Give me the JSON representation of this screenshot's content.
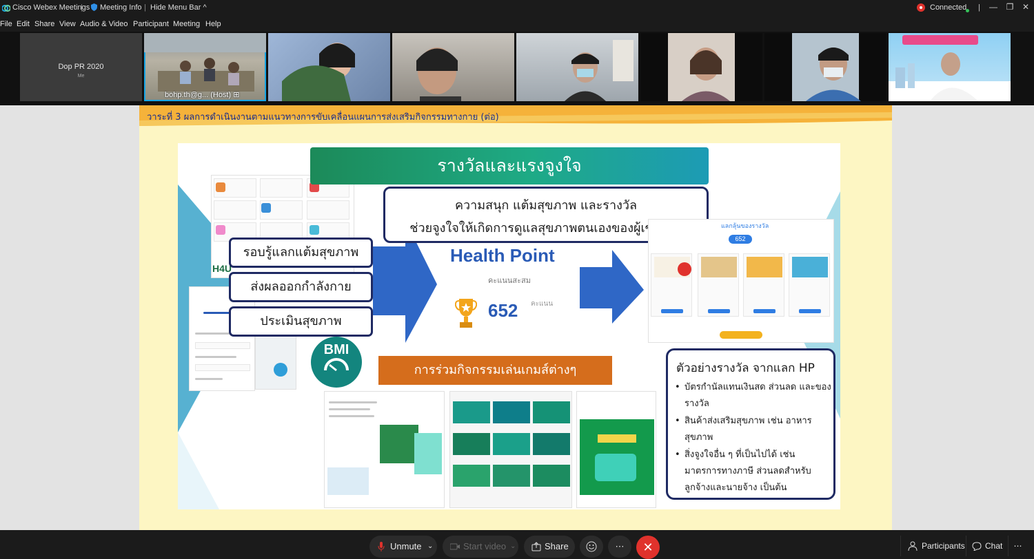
{
  "titlebar": {
    "app_name": "Cisco Webex Meetings",
    "meeting_info": "Meeting Info",
    "hide_menu": "Hide Menu Bar",
    "connected": "Connected"
  },
  "menu": [
    "File",
    "Edit",
    "Share",
    "View",
    "Audio & Video",
    "Participant",
    "Meeting",
    "Help"
  ],
  "participants": {
    "me_name": "Dop PR 2020",
    "me_sub": "Me",
    "host_label": "bohp.th@g... (Host)"
  },
  "slide": {
    "title": "วาระที่ 3  ผลการดำเนินงานตามแนวทางการขับเคลื่อนแผนการส่งเสริมกิจกรรมทางกาย (ต่อ)",
    "banner": "รางวัลและแรงจูงใจ",
    "motto_line1": "ความสนุก แต้มสุขภาพ และรางวัล",
    "motto_line2": "ช่วยจูงใจให้เกิดการดูแลสุขภาพตนเองของผู้เข้าร่วม",
    "pills": [
      "รอบรู้แลกแต้มสุขภาพ",
      "ส่งผลออกกำลังกาย",
      "ประเมินสุขภาพ"
    ],
    "health_point_title": "Health Point",
    "health_point_sub": "คะแนนสะสม",
    "health_point_value": "652",
    "health_point_unit": "คะแนน",
    "games_bar": "การร่วมกิจกรรมเล่นเกมส์ต่างๆ",
    "reward_title": "ตัวอย่างรางวัล จากแลก HP",
    "reward_items": [
      "บัตรกำนัลแทนเงินสด ส่วนลด และของรางวัล",
      "สินค้าส่งเสริมสุขภาพ เช่น อาหารสุขภาพ",
      "สิ่งจูงใจอื่น ๆ ที่เป็นไปได้ เช่น มาตรการทางภาษี ส่วนลดสำหรับลูกจ้างและนายจ้าง เป็นต้น"
    ],
    "bmi_label": "BMI",
    "h4u_label": "H4U",
    "exchange_title": "แลกลุ้นของรางวัล",
    "exchange_points": "652"
  },
  "controls": {
    "unmute": "Unmute",
    "start_video": "Start video",
    "share": "Share",
    "participants": "Participants",
    "chat": "Chat"
  },
  "colors": {
    "accent_blue": "#16a6e6",
    "end_red": "#e0322c",
    "slide_bg": "#fdf6c3",
    "banner_green": "#1eaa85",
    "orange": "#d56d1c",
    "navy": "#1f2a63"
  }
}
